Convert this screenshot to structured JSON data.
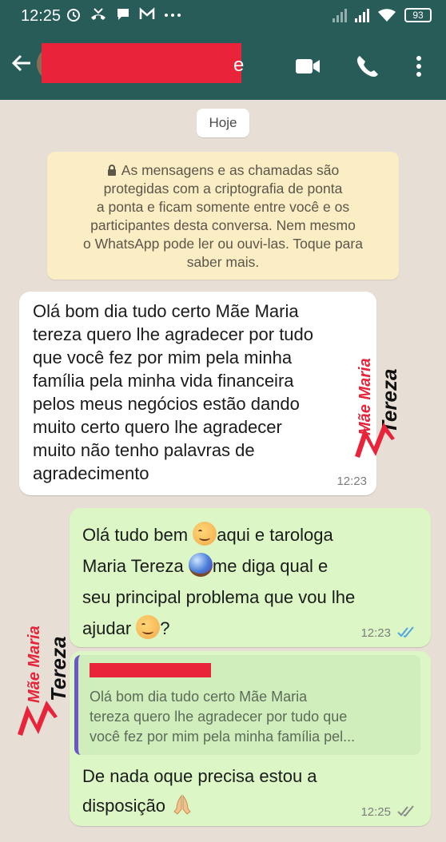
{
  "status_bar": {
    "time": "12:25",
    "battery": "93",
    "left_icons": [
      "alarm-icon",
      "missed-call-icon",
      "chat-icon",
      "gmail-icon",
      "more-dots-icon"
    ],
    "right_icons": [
      "signal-1-icon",
      "signal-2-icon",
      "wifi-icon",
      "battery-icon"
    ]
  },
  "header": {
    "contact_name": "",
    "name_tail": "e",
    "icons": [
      "back-arrow-icon",
      "video-call-icon",
      "phone-icon",
      "more-vert-icon"
    ],
    "color": "#275c58"
  },
  "chat": {
    "date_chip": "Hoje",
    "encryption_notice": {
      "lines": [
        "As mensagens e as chamadas são",
        "protegidas com a criptografia de ponta",
        "a ponta e ficam somente entre você e os",
        "participantes desta conversa. Nem mesmo",
        "o WhatsApp pode ler ou ouvi-las. Toque para",
        "saber mais."
      ]
    },
    "messages": [
      {
        "direction": "incoming",
        "lines": [
          "Olá bom dia tudo certo Mãe Maria",
          "tereza quero lhe agradecer por tudo",
          "que você fez por mim pela minha",
          "família pela minha vida financeira",
          "pelos meus negócios estão dando",
          "muito certo quero lhe agradecer",
          "muito não tenho palavras de",
          "agradecimento"
        ],
        "time": "12:23"
      },
      {
        "direction": "outgoing",
        "line1_a": "Olá tudo bem",
        "line1_b": "aqui e tarologa",
        "line2_a": "Maria Tereza",
        "line2_b": "me diga qual e",
        "line3": "seu principal problema que vou lhe",
        "line4_a": "ajudar",
        "line4_b": "?",
        "time": "12:23",
        "status": "read"
      },
      {
        "direction": "outgoing",
        "quote": {
          "author": "",
          "lines": [
            "Olá bom dia tudo certo Mãe Maria",
            "tereza quero lhe agradecer por tudo que",
            "você fez por mim pela minha família pel..."
          ]
        },
        "line1": "De nada oque precisa estou a",
        "line2": "disposição",
        "time": "12:25",
        "status": "delivered"
      }
    ]
  },
  "watermark": {
    "small": "Mãe Maria",
    "big": "Tereza",
    "color": "#e8233a"
  }
}
